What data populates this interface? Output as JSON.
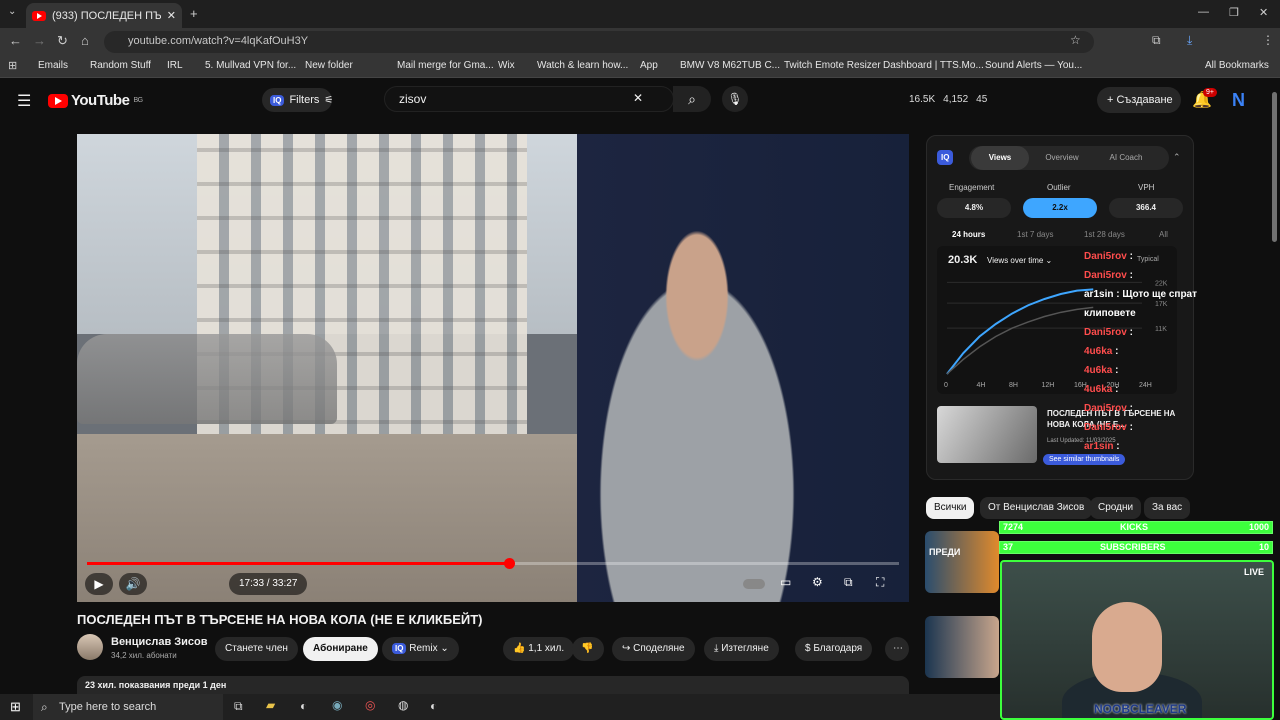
{
  "browser": {
    "tab_title": "(933) ПОСЛЕДЕН ПЪТ В ТЪ...",
    "url": "youtube.com/watch?v=4lqKafOuH3Y",
    "bookmarks": [
      "Emails",
      "Random Stuff",
      "IRL",
      "5. Mullvad VPN for...",
      "New folder",
      "Mail merge for Gma...",
      "Wix",
      "Watch & learn how...",
      "App",
      "BMW V8 M62TUB C...",
      "Twitch Emote Resizer",
      "Dashboard | TTS.Mo...",
      "Sound Alerts — You..."
    ],
    "all_bookmarks": "All Bookmarks"
  },
  "header": {
    "logo_text": "YouTube",
    "logo_country": "BG",
    "filters_label": "Filters",
    "iq_label": "IQ",
    "search_value": "zisov",
    "stats": [
      "16.5K",
      "4,152",
      "45"
    ],
    "create_label": "Създаване",
    "notif_badge": "9+",
    "avatar_letter": "N"
  },
  "player": {
    "time": "17:33 / 33:27",
    "progress_fraction": 0.52,
    "buffer_fraction": 0.55
  },
  "video": {
    "title": "ПОСЛЕДЕН ПЪТ В ТЪРСЕНЕ НА НОВА КОЛА (НЕ Е КЛИКБЕЙТ)",
    "channel": "Венцислав Зисов",
    "subs": "34,2 хил. абонати",
    "join": "Станете член",
    "subscribe": "Абониране",
    "remix": "Remix",
    "likes": "1,1 хил.",
    "share": "Споделяне",
    "download": "Изтегляне",
    "thanks": "Благодаря",
    "views_line": "23 хил. показвания  преди 1 ден"
  },
  "panel": {
    "tabs": [
      "Views",
      "Overview",
      "AI Coach"
    ],
    "metrics": [
      {
        "label": "Engagement",
        "value": "4.8%"
      },
      {
        "label": "Outlier",
        "value": "2.2x"
      },
      {
        "label": "VPH",
        "value": "366.4"
      }
    ],
    "ranges": [
      "24 hours",
      "1st 7 days",
      "1st 28 days",
      "All"
    ],
    "total": "20.3K",
    "views_over_time": "Views over time",
    "typical": "Typical",
    "y_ticks": [
      "22K",
      "17K",
      "11K"
    ],
    "x_ticks": [
      "0",
      "4H",
      "8H",
      "12H",
      "16H",
      "20H",
      "24H"
    ],
    "related_title": "ПОСЛЕДЕН ПЪТ В ТЪРСЕНЕ НА НОВА КОЛА (НЕ Е...",
    "related_sub": "Last Updated: 11/03/2025",
    "see_similar": "See similar thumbnails"
  },
  "chart_data": {
    "type": "line",
    "title": "",
    "xlabel": "",
    "ylabel": "",
    "x": [
      0,
      2,
      4,
      6,
      8,
      10,
      12,
      14,
      16,
      18
    ],
    "series": [
      {
        "values": [
          0,
          5,
          9,
          12,
          14.5,
          16.5,
          18,
          19.2,
          20,
          20.3
        ]
      },
      {
        "values": [
          0,
          3.5,
          6.5,
          9,
          11,
          12.5,
          13.8,
          14.8,
          15.5,
          16
        ]
      }
    ],
    "ylim": [
      0,
      24
    ],
    "xlim": [
      0,
      24
    ]
  },
  "chat": [
    {
      "user": "Dani5rov",
      "msg": ":",
      "color": "red"
    },
    {
      "user": "Dani5rov",
      "msg": ":",
      "color": "red"
    },
    {
      "user": "ar1sin",
      "msg": ": Щото ще спрат",
      "color": "white"
    },
    {
      "user": "",
      "msg": "клиповете",
      "color": "white"
    },
    {
      "user": "Dani5rov",
      "msg": ":",
      "color": "red"
    },
    {
      "user": "4u6ka",
      "msg": ":",
      "color": "red"
    },
    {
      "user": "4u6ka",
      "msg": ":",
      "color": "red"
    },
    {
      "user": "4u6ka",
      "msg": ":",
      "color": "red"
    },
    {
      "user": "Dani5rov",
      "msg": ":",
      "color": "red"
    },
    {
      "user": "Dani5rov",
      "msg": ":",
      "color": "red"
    },
    {
      "user": "ar1sin",
      "msg": ":",
      "color": "red"
    }
  ],
  "chips": [
    "Всички",
    "От Венцислав Зисов",
    "Сродни",
    "За вас"
  ],
  "stream": {
    "kicks_count": "7274",
    "kicks_label": "KICKS",
    "kicks_goal": "1000",
    "subs_count": "37",
    "subs_label": "SUBSCRIBERS",
    "subs_goal": "10",
    "live": "LIVE",
    "nickname": "NOOBCLEAVER",
    "side_thumb_text": "ПРЕДИ"
  },
  "taskbar": {
    "search_placeholder": "Type here to search"
  },
  "colors": {
    "accent_red": "#ff0000",
    "iq_blue": "#3b5bdb",
    "outlier_blue": "#3ea6ff",
    "stream_green": "#3dff3d"
  }
}
